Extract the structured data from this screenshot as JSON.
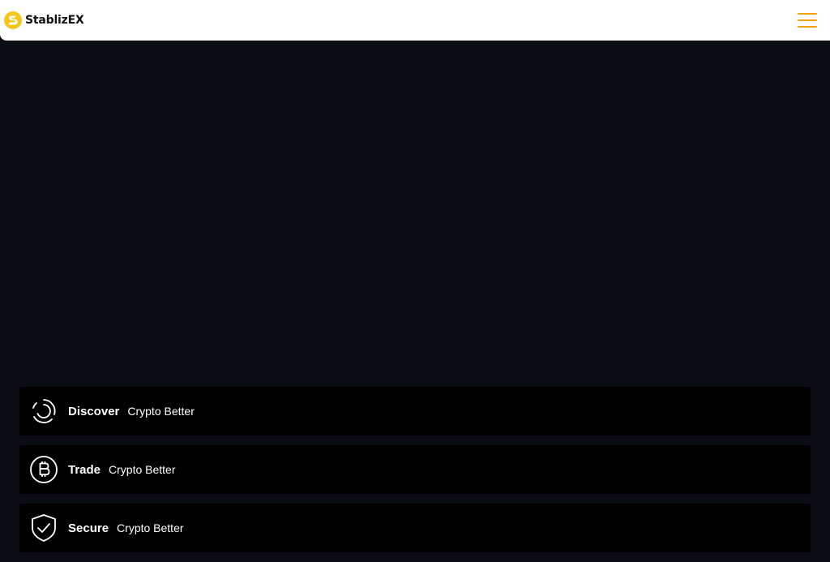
{
  "brand": {
    "name": "StablizEX",
    "accent_color": "#f4a300",
    "logo_color": "#f5c518"
  },
  "header": {
    "menu_icon": "hamburger-menu-icon"
  },
  "features": [
    {
      "title": "Discover",
      "subtitle": "Crypto Better",
      "icon": "orbit-loader-icon"
    },
    {
      "title": "Trade",
      "subtitle": "Crypto Better",
      "icon": "bitcoin-icon"
    },
    {
      "title": "Secure",
      "subtitle": "Crypto Better",
      "icon": "shield-check-icon"
    }
  ]
}
